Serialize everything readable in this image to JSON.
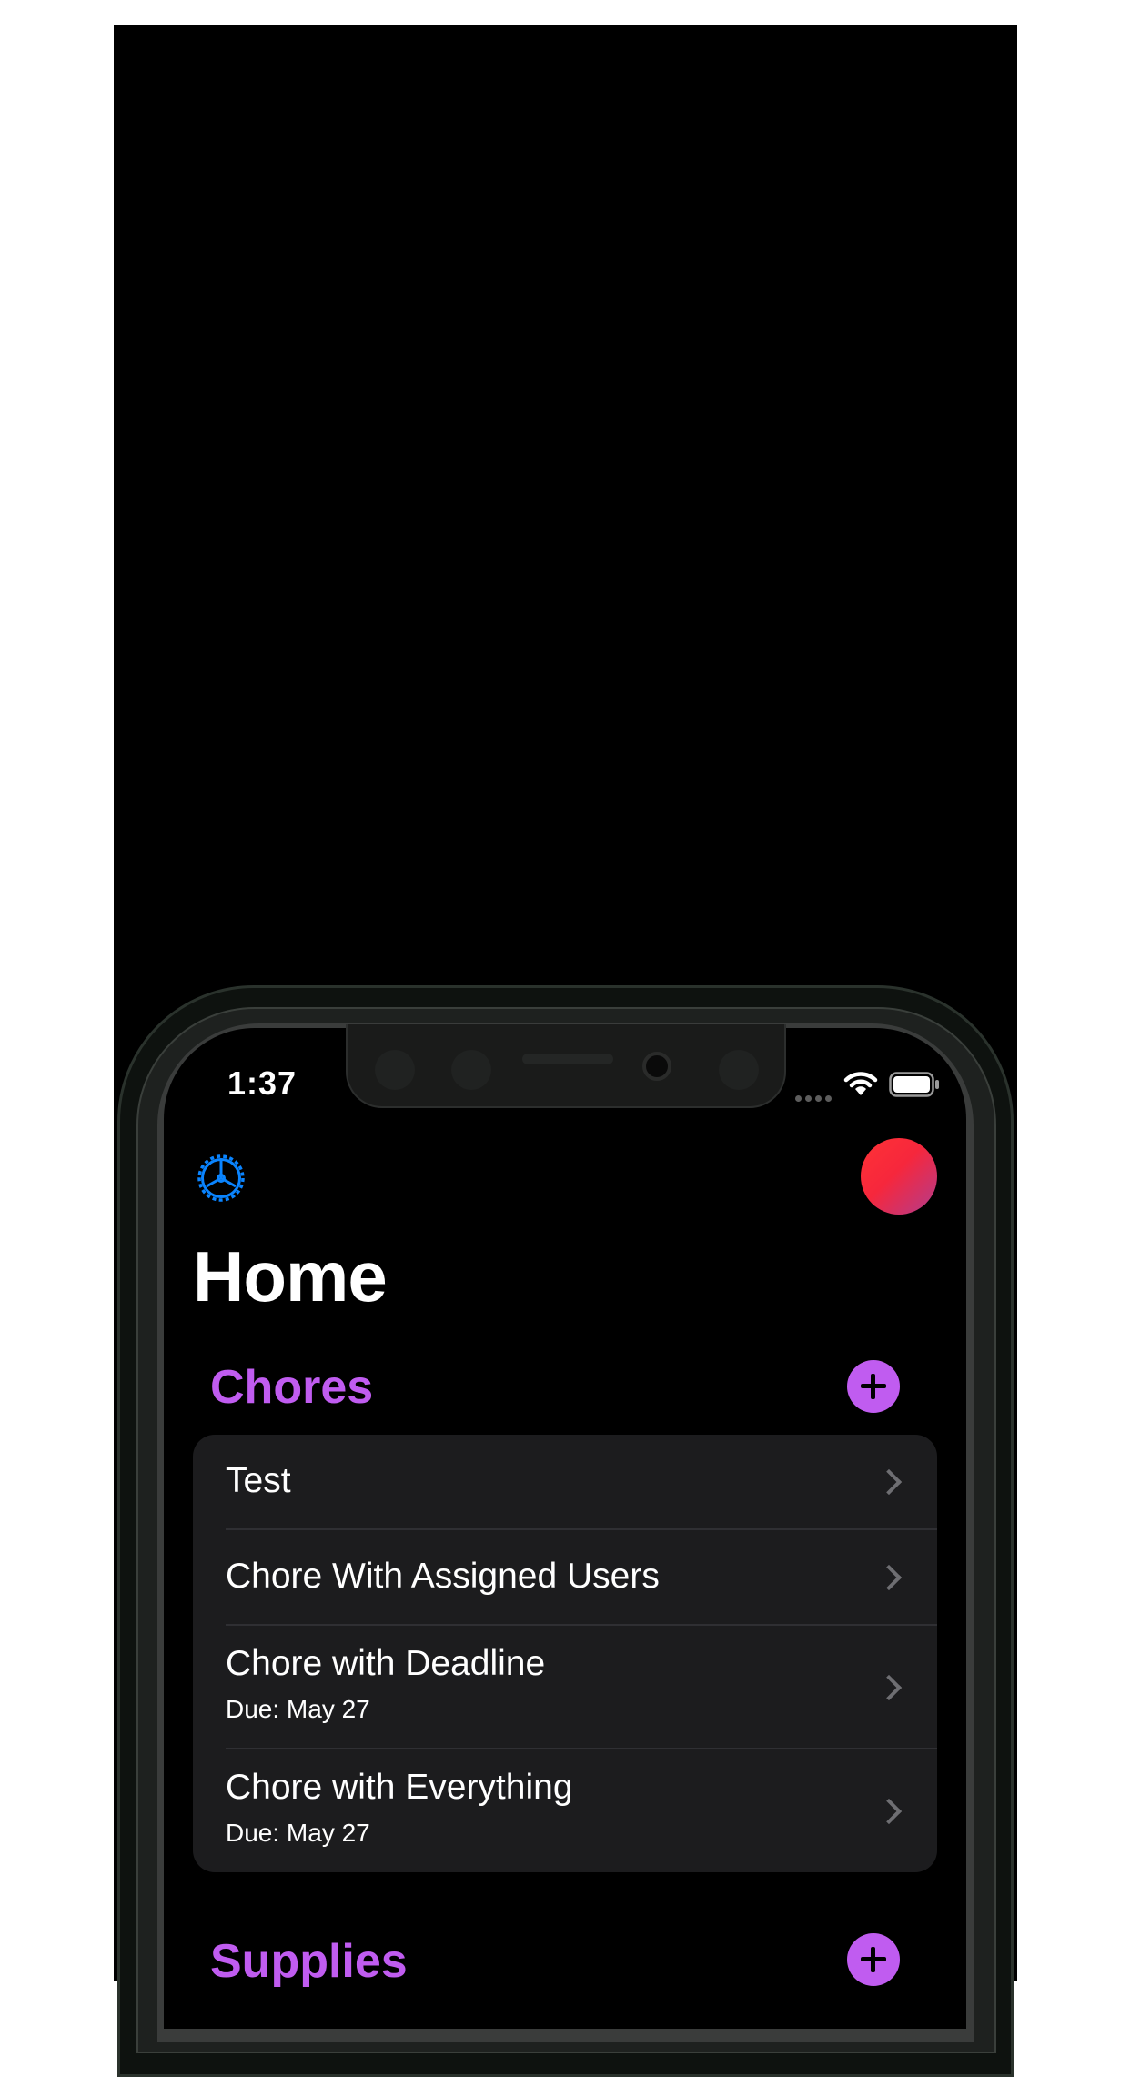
{
  "status_bar": {
    "time": "1:37"
  },
  "page": {
    "title": "Home"
  },
  "sections": {
    "chores": {
      "title": "Chores"
    },
    "supplies": {
      "title": "Supplies"
    }
  },
  "chores": [
    {
      "title": "Test",
      "due": ""
    },
    {
      "title": "Chore With Assigned Users",
      "due": ""
    },
    {
      "title": "Chore with Deadline",
      "due": "Due: May 27"
    },
    {
      "title": "Chore with Everything",
      "due": "Due: May 27"
    }
  ],
  "colors": {
    "accent": "#c05cf0",
    "settings_icon": "#0a84ff",
    "avatar_gradient_start": "#ff3236",
    "avatar_gradient_end": "#b23c8d",
    "card_background": "#1c1c1e"
  },
  "icons": {
    "settings": "gear-icon",
    "add": "plus-circle-icon",
    "row": "chevron-right-icon",
    "wifi": "wifi-icon",
    "battery": "battery-icon"
  }
}
